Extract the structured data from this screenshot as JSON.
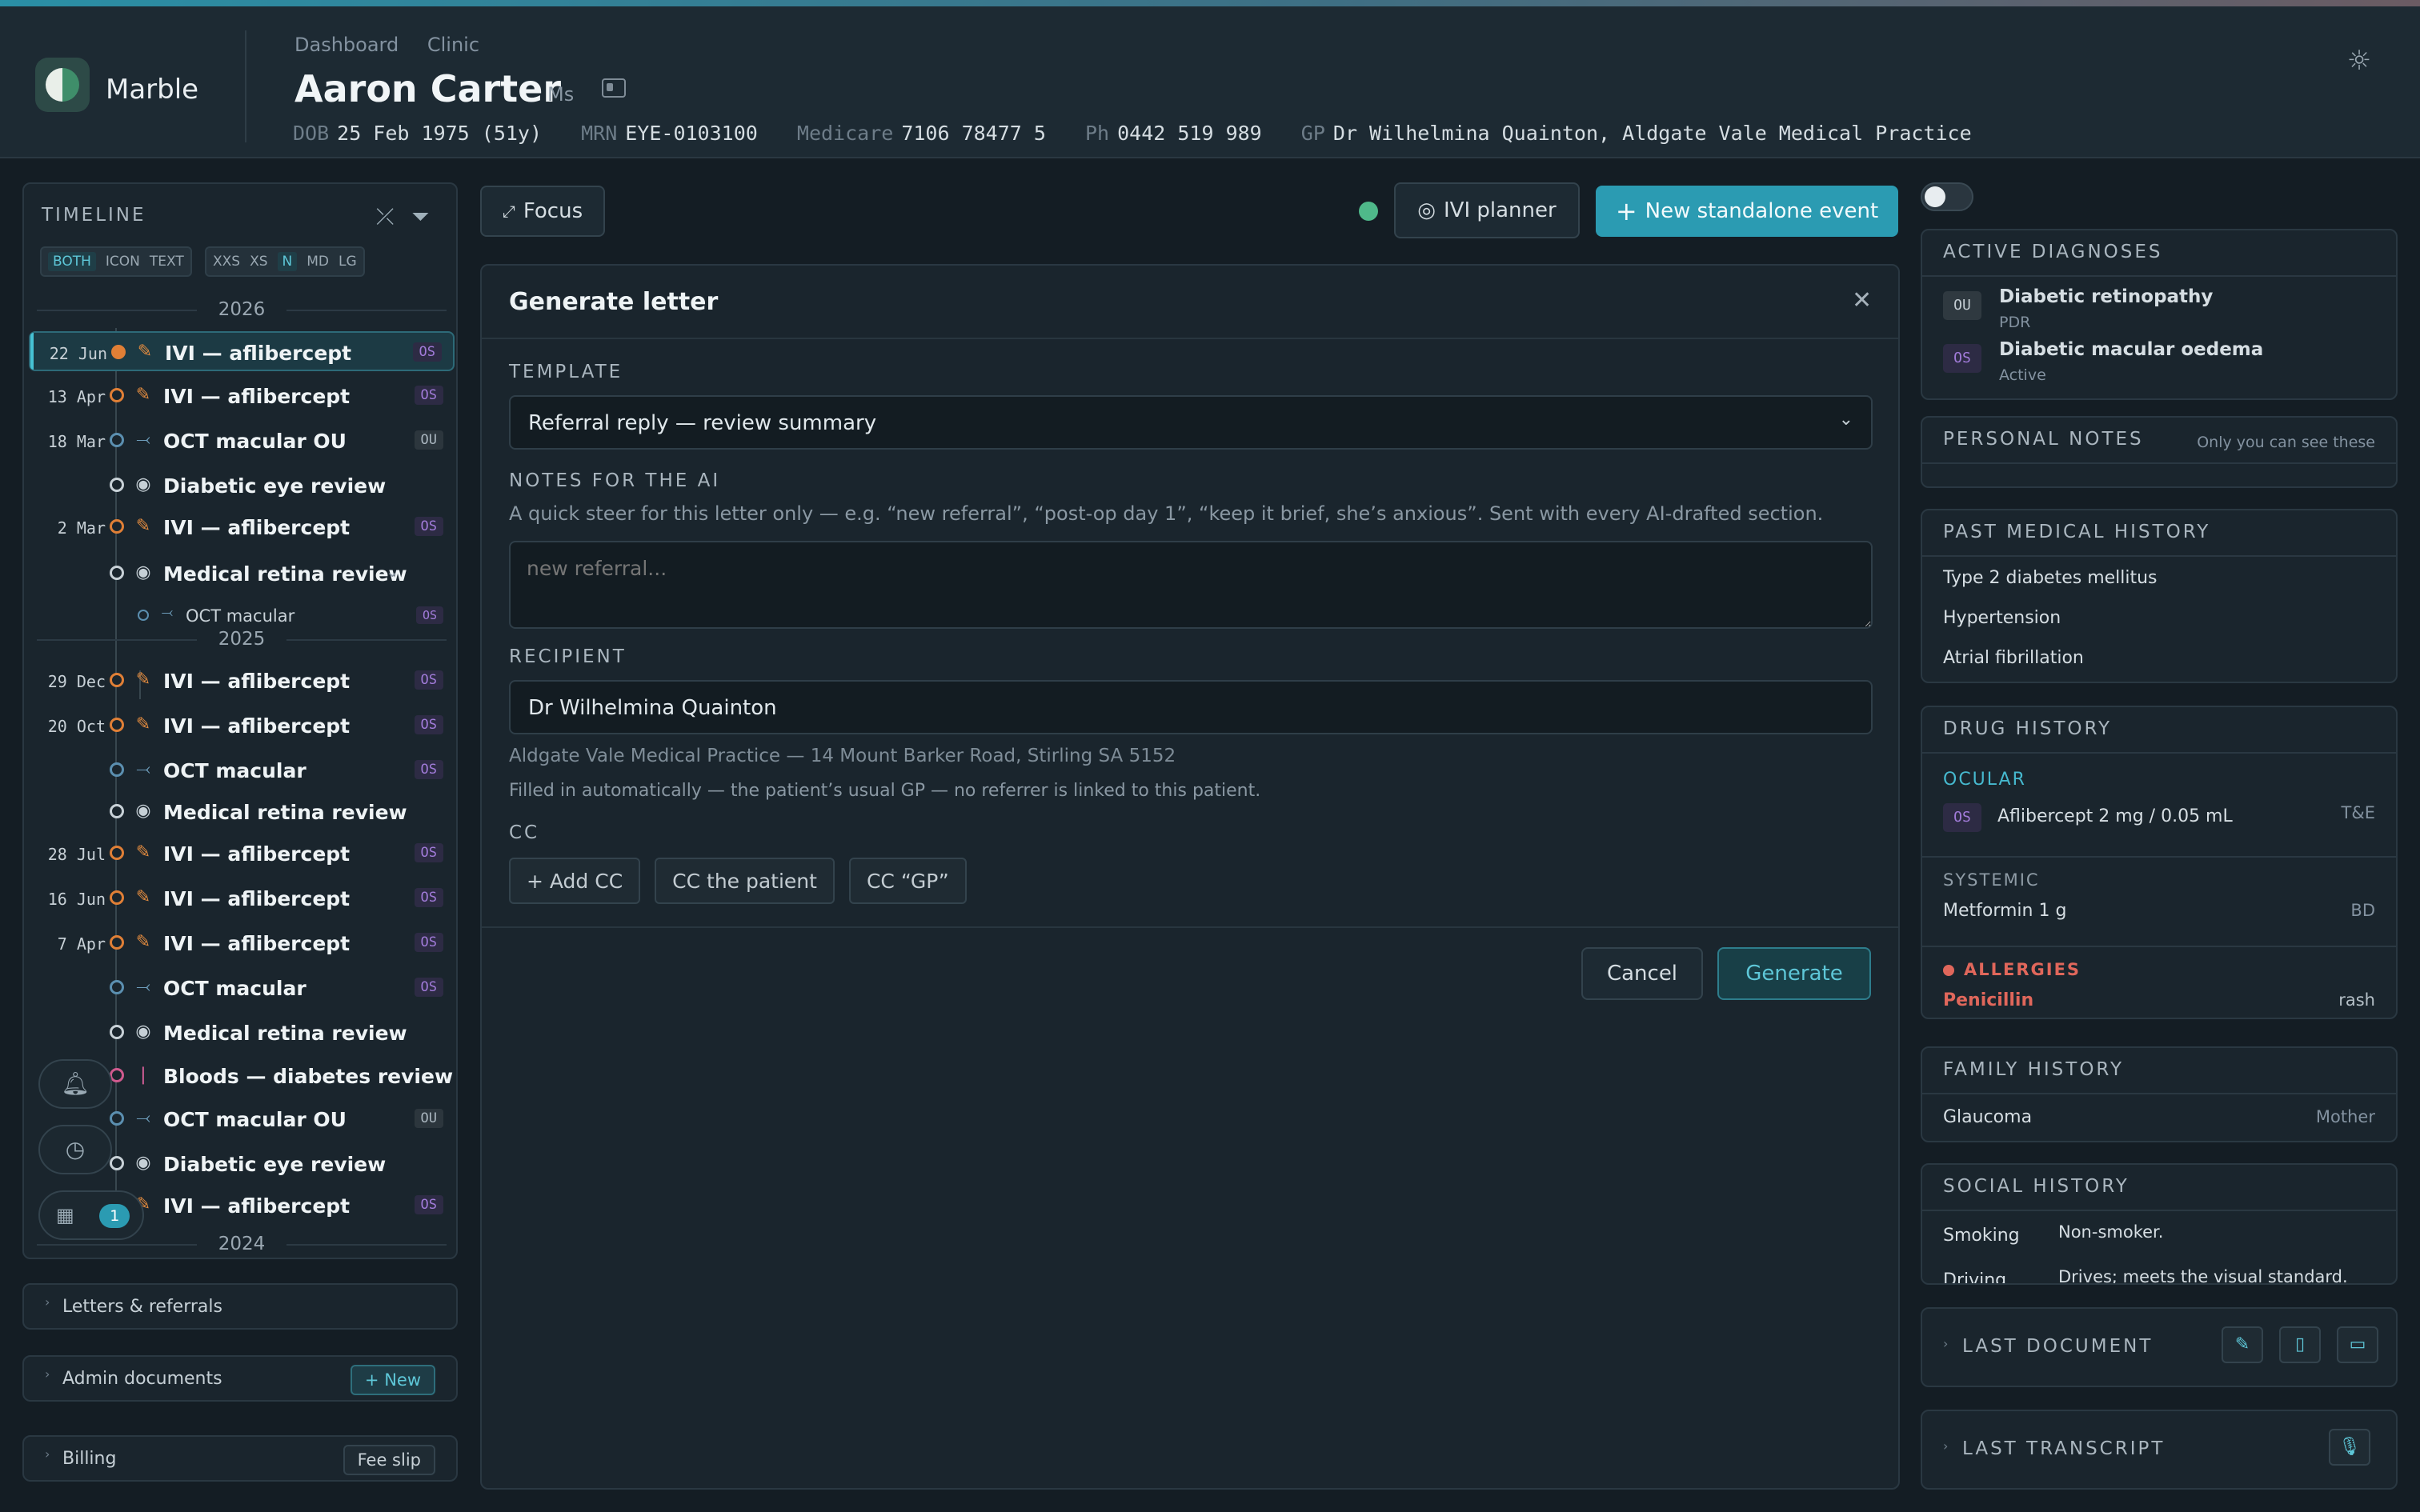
{
  "app": {
    "brand": "Marble"
  },
  "breadcrumbs": [
    "Dashboard",
    "Clinic"
  ],
  "patient": {
    "name": "Aaron Carter",
    "title": "Ms",
    "dob_label": "DOB",
    "dob": "25 Feb 1975 (51y)",
    "mrn_label": "MRN",
    "mrn": "EYE-0103100",
    "medicare_label": "Medicare",
    "medicare": "7106 78477 5",
    "ph_label": "Ph",
    "ph": "0442 519 989",
    "gp_label": "GP",
    "gp": "Dr Wilhelmina Quainton, Aldgate Vale Medical Practice"
  },
  "timeline": {
    "title": "TIMELINE",
    "mode_options": [
      "BOTH",
      "ICON",
      "TEXT"
    ],
    "mode_selected": "BOTH",
    "size_options": [
      "XXS",
      "XS",
      "N",
      "MD",
      "LG"
    ],
    "size_selected": "N",
    "years": [
      "2026",
      "2025",
      "2024"
    ],
    "rows_2026": [
      {
        "date": "22 Jun",
        "label": "IVI — aflibercept",
        "eye": "OS",
        "kind": "ivi",
        "selected": true
      },
      {
        "date": "13 Apr",
        "label": "IVI — aflibercept",
        "eye": "OS",
        "kind": "ivi"
      },
      {
        "date": "18 Mar",
        "label": "OCT macular OU",
        "eye": "OU",
        "kind": "oct"
      },
      {
        "date": "",
        "label": "Diabetic eye review",
        "eye": "",
        "kind": "review"
      },
      {
        "date": "2 Mar",
        "label": "IVI — aflibercept",
        "eye": "OS",
        "kind": "ivi"
      },
      {
        "date": "",
        "label": "Medical retina review",
        "eye": "",
        "kind": "review"
      },
      {
        "date": "",
        "label": "OCT macular",
        "eye": "OS",
        "kind": "oct-sub"
      }
    ],
    "rows_2025": [
      {
        "date": "29 Dec",
        "label": "IVI — aflibercept",
        "eye": "OS",
        "kind": "ivi"
      },
      {
        "date": "20 Oct",
        "label": "IVI — aflibercept",
        "eye": "OS",
        "kind": "ivi"
      },
      {
        "date": "",
        "label": "OCT macular",
        "eye": "OS",
        "kind": "oct"
      },
      {
        "date": "",
        "label": "Medical retina review",
        "eye": "",
        "kind": "review"
      },
      {
        "date": "28 Jul",
        "label": "IVI — aflibercept",
        "eye": "OS",
        "kind": "ivi"
      },
      {
        "date": "16 Jun",
        "label": "IVI — aflibercept",
        "eye": "OS",
        "kind": "ivi"
      },
      {
        "date": "7 Apr",
        "label": "IVI — aflibercept",
        "eye": "OS",
        "kind": "ivi"
      },
      {
        "date": "",
        "label": "OCT macular",
        "eye": "OS",
        "kind": "oct"
      },
      {
        "date": "",
        "label": "Medical retina review",
        "eye": "",
        "kind": "review"
      },
      {
        "date": "",
        "label": "Bloods — diabetes review",
        "eye": "",
        "kind": "bloods"
      },
      {
        "date": "",
        "label": "OCT macular OU",
        "eye": "OU",
        "kind": "oct"
      },
      {
        "date": "",
        "label": "Diabetic eye review",
        "eye": "",
        "kind": "review"
      },
      {
        "date": "",
        "label": "IVI — aflibercept",
        "eye": "OS",
        "kind": "ivi"
      }
    ],
    "calendar_badge": "1"
  },
  "sections": {
    "letters": "Letters & referrals",
    "admin": "Admin documents",
    "admin_button": "+ New",
    "billing": "Billing",
    "billing_button": "Fee slip"
  },
  "toolbar": {
    "focus": "Focus",
    "ivi_planner": "IVI planner",
    "new_event": "New standalone event"
  },
  "dialog": {
    "title": "Generate letter",
    "template_label": "TEMPLATE",
    "template_value": "Referral reply — review summary",
    "notes_label": "NOTES FOR THE AI",
    "notes_help": "A quick steer for this letter only — e.g. “new referral”, “post-op day 1”, “keep it brief, she’s anxious”. Sent with every AI-drafted section.",
    "notes_placeholder": "new referral...",
    "recipient_label": "RECIPIENT",
    "recipient_value": "Dr Wilhelmina Quainton",
    "recipient_address": "Aldgate Vale Medical Practice — 14 Mount Barker Road, Stirling SA 5152",
    "recipient_note": "Filled in automatically — the patient’s usual GP — no referrer is linked to this patient.",
    "cc_label": "CC",
    "cc_buttons": [
      "+ Add CC",
      "CC the patient",
      "CC “GP”"
    ],
    "cancel": "Cancel",
    "generate": "Generate"
  },
  "right": {
    "diagnoses_title": "ACTIVE DIAGNOSES",
    "diagnoses": [
      {
        "eye": "OU",
        "name": "Diabetic retinopathy",
        "status": "PDR"
      },
      {
        "eye": "OS",
        "name": "Diabetic macular oedema",
        "status": "Active"
      }
    ],
    "notes_title": "PERSONAL NOTES",
    "notes_hint": "Only you can see these",
    "pmh_title": "PAST MEDICAL HISTORY",
    "pmh": [
      "Type 2 diabetes mellitus",
      "Hypertension",
      "Atrial fibrillation"
    ],
    "drug_title": "DRUG HISTORY",
    "ocular_label": "OCULAR",
    "ocular": {
      "eye": "OS",
      "name": "Aflibercept 2 mg / 0.05 mL",
      "regimen": "T&E"
    },
    "systemic_label": "SYSTEMIC",
    "systemic": {
      "name": "Metformin 1 g",
      "freq": "BD"
    },
    "allergies_label": "ALLERGIES",
    "allergy": {
      "name": "Penicillin",
      "reaction": "rash"
    },
    "family_title": "FAMILY HISTORY",
    "family": {
      "condition": "Glaucoma",
      "relation": "Mother"
    },
    "social_title": "SOCIAL HISTORY",
    "social": [
      {
        "key": "Smoking",
        "value": "Non-smoker."
      },
      {
        "key": "Driving",
        "value": "Drives; meets the visual standard."
      }
    ],
    "last_document": "LAST DOCUMENT",
    "last_transcript": "LAST TRANSCRIPT"
  },
  "colors": {
    "accent": "#2b9bb2",
    "ivi": "#e07f36",
    "os": "#a17bd9",
    "allergy": "#e0675b"
  }
}
